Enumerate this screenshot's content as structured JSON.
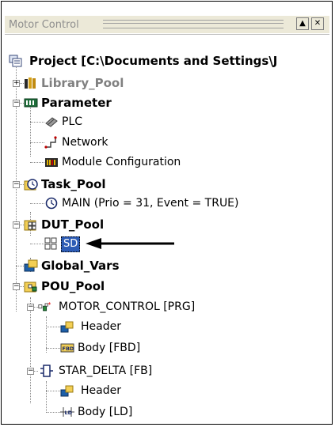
{
  "window": {
    "title": "Motor Control",
    "minimize_glyph": "▲",
    "close_glyph": "✕"
  },
  "tree": {
    "project": "Project [C:\\Documents and Settings\\J",
    "library_pool": "Library_Pool",
    "parameter": "Parameter",
    "plc": "PLC",
    "network": "Network",
    "module_configuration": "Module Configuration",
    "task_pool": "Task_Pool",
    "main_task": "MAIN (Prio = 31, Event = TRUE)",
    "dut_pool": "DUT_Pool",
    "sd": "SD",
    "global_vars": "Global_Vars",
    "pou_pool": "POU_Pool",
    "motor_control": "MOTOR_CONTROL [PRG]",
    "motor_header": "Header",
    "motor_body": "Body [FBD]",
    "star_delta": "STAR_DELTA [FB]",
    "star_header": "Header",
    "star_body": "Body [LD]"
  },
  "icons": {
    "project": "project-icon",
    "library": "library-books-icon",
    "parameter": "parameter-board-icon",
    "plc": "plc-chip-icon",
    "network": "network-icon",
    "module": "module-icon",
    "task": "clock-icon",
    "dut": "dut-icon",
    "global": "global-vars-icon",
    "pou": "pou-icon",
    "prg": "prg-icon",
    "header": "header-icon",
    "fbd": "fbd-icon",
    "fb": "function-block-icon",
    "ld": "ladder-icon",
    "arrow": "arrow-left-icon"
  },
  "colors": {
    "selection": "#2d5cb5",
    "title_text": "#8e8e8e",
    "library_text": "#808080"
  }
}
